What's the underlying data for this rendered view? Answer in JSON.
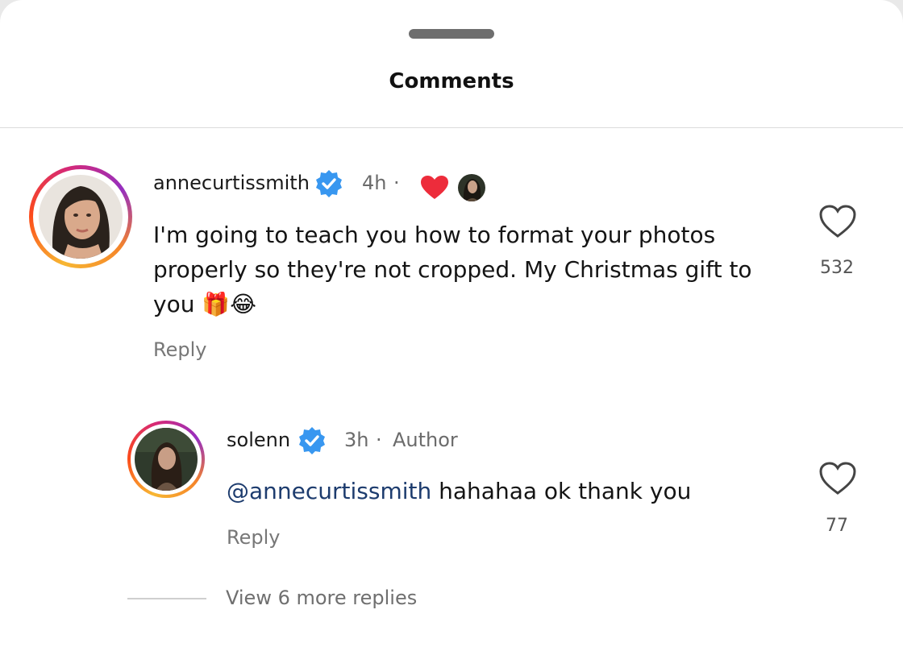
{
  "sheet": {
    "title": "Comments"
  },
  "comments": [
    {
      "username": "annecurtissmith",
      "verified": true,
      "time": "4h",
      "separator": "·",
      "text_lines": [
        "I'm going to teach you how to format your photos",
        "properly so they're not cropped. My Christmas gift to",
        "you"
      ],
      "emojis": "🎁😂",
      "reply_label": "Reply",
      "like_count": "532"
    }
  ],
  "reply": {
    "username": "solenn",
    "verified": true,
    "time": "3h",
    "separator": "·",
    "author_badge": "Author",
    "mention": "@annecurtissmith",
    "text": " hahahaa ok thank you",
    "reply_label": "Reply",
    "like_count": "77"
  },
  "view_more_replies": "View 6 more replies",
  "colors": {
    "verified_blue": "#3897f0",
    "heart_red": "#ed2c3b",
    "mention_blue": "#1d3c6e"
  }
}
